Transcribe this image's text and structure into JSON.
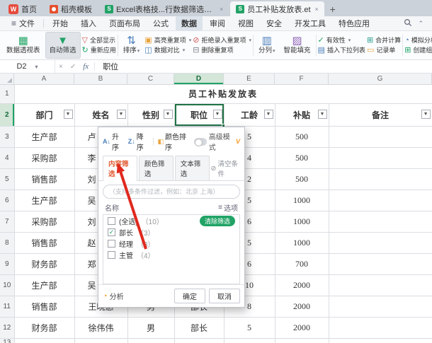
{
  "colors": {
    "accent_green": "#21a366",
    "selection_border": "#217346",
    "annotation_arrow": "#e0281e"
  },
  "tab_bar": {
    "home": "首页",
    "template": "稻壳模板",
    "documents": [
      {
        "title": "Excel表格技...行数据筛选和排序",
        "active": false
      },
      {
        "title": "员工补贴发放表.et",
        "active": true
      }
    ],
    "new_tab": "+"
  },
  "menu": {
    "file": "文件",
    "tabs": [
      "开始",
      "插入",
      "页面布局",
      "公式",
      "数据",
      "审阅",
      "视图",
      "安全",
      "开发工具",
      "特色应用"
    ],
    "active_tab": "数据"
  },
  "ribbon": {
    "groups": [
      {
        "type": "big",
        "label": "数据透视表",
        "icon": "pivot-table"
      },
      {
        "type": "big",
        "label": "自动筛选",
        "icon": "funnel",
        "highlighted": true
      },
      {
        "type": "stack",
        "items": [
          {
            "label": "全部显示",
            "icon": "show-all"
          },
          {
            "label": "重新应用",
            "icon": "reapply"
          }
        ]
      },
      {
        "type": "big",
        "label": "排序",
        "icon": "sort",
        "arrow": true
      },
      {
        "type": "stack",
        "items": [
          {
            "label": "高亮重复项",
            "icon": "highlight-duplicates",
            "arrow": true
          },
          {
            "label": "数据对比",
            "icon": "data-compare",
            "arrow": true
          }
        ]
      },
      {
        "type": "stack",
        "items": [
          {
            "label": "拒绝录入重复项",
            "icon": "reject-duplicates",
            "arrow": true
          },
          {
            "label": "删除重复项",
            "icon": "delete-duplicates"
          }
        ]
      },
      {
        "type": "big",
        "label": "分列",
        "icon": "text-to-columns",
        "arrow": true
      },
      {
        "type": "big",
        "label": "智能填充",
        "icon": "smart-fill"
      },
      {
        "type": "stack",
        "items": [
          {
            "label": "有效性",
            "icon": "validation",
            "arrow": true
          },
          {
            "label": "插入下拉列表",
            "icon": "insert-dropdown"
          }
        ]
      },
      {
        "type": "stack",
        "items": [
          {
            "label": "合并计算",
            "icon": "consolidate"
          },
          {
            "label": "记录单",
            "icon": "record-form"
          }
        ]
      },
      {
        "type": "stack",
        "items": [
          {
            "label": "模拟分析",
            "icon": "what-if-analysis",
            "arrow": true
          },
          {
            "label": "创建组",
            "icon": "create-group"
          }
        ]
      }
    ]
  },
  "formula_bar": {
    "cell_ref": "D2",
    "fx_label": "fx",
    "value": "职位"
  },
  "sheet": {
    "column_letters": [
      "A",
      "B",
      "C",
      "D",
      "E",
      "F",
      "G"
    ],
    "selected_column": "D",
    "row_numbers": [
      "1",
      "2",
      "3",
      "4",
      "5",
      "6",
      "7",
      "8",
      "9",
      "10",
      "11",
      "12",
      "13"
    ],
    "title": "员工补贴发放表",
    "headers": [
      "部门",
      "姓名",
      "性别",
      "职位",
      "工龄",
      "补贴",
      "备注"
    ],
    "rows": [
      [
        "生产部",
        "卢",
        "",
        "",
        "5",
        "500",
        ""
      ],
      [
        "采购部",
        "李",
        "",
        "",
        "4",
        "500",
        ""
      ],
      [
        "销售部",
        "刘",
        "",
        "",
        "2",
        "500",
        ""
      ],
      [
        "生产部",
        "吴",
        "",
        "",
        "5",
        "1000",
        ""
      ],
      [
        "采购部",
        "刘",
        "",
        "",
        "6",
        "1000",
        ""
      ],
      [
        "销售部",
        "赵",
        "",
        "",
        "5",
        "1000",
        ""
      ],
      [
        "财务部",
        "郑",
        "",
        "",
        "6",
        "700",
        ""
      ],
      [
        "生产部",
        "吴",
        "",
        "",
        "10",
        "2000",
        ""
      ],
      [
        "销售部",
        "王晓惠",
        "男",
        "部长",
        "8",
        "2000",
        ""
      ],
      [
        "财务部",
        "徐伟伟",
        "男",
        "部长",
        "5",
        "2000",
        ""
      ]
    ]
  },
  "filter_panel": {
    "sort": {
      "asc": "升序",
      "desc": "降序",
      "color": "颜色排序",
      "advanced": "高级模式"
    },
    "tabs": [
      {
        "label": "内容筛选",
        "active": true
      },
      {
        "label": "颜色筛选",
        "active": false
      },
      {
        "label": "文本筛选",
        "active": false
      }
    ],
    "clear_conditions": "清空条件",
    "search_placeholder": "（支持多条件过滤，例如：北京 上海）",
    "list_header": {
      "name": "名称",
      "options": "选项"
    },
    "clear_filter": "清除筛选",
    "items": [
      {
        "label": "(全选)",
        "count": "（10）",
        "checked": false
      },
      {
        "label": "部长",
        "count": "（3）",
        "checked": true
      },
      {
        "label": "经理",
        "count": "（3）",
        "checked": false
      },
      {
        "label": "主管",
        "count": "（4）",
        "checked": false
      }
    ],
    "analyze": "分析",
    "ok": "确定",
    "cancel": "取消"
  }
}
